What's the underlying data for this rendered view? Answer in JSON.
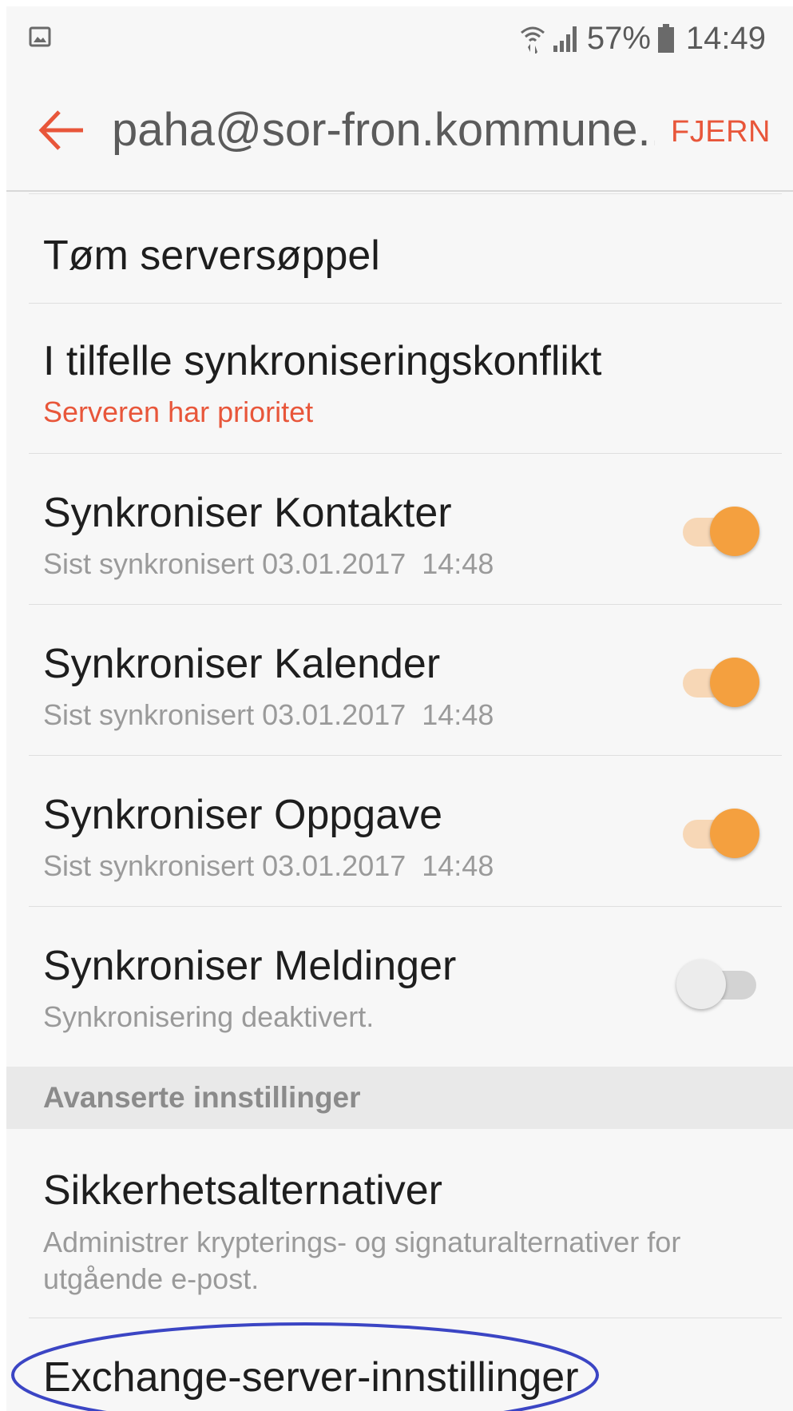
{
  "status_bar": {
    "battery": "57%",
    "time": "14:49",
    "icons": [
      "gallery-icon",
      "wifi-icon",
      "signal-icon",
      "battery-icon"
    ]
  },
  "action_bar": {
    "back_icon": "back-arrow-icon",
    "title": "paha@sor-fron.kommune...",
    "remove_label": "FJERN"
  },
  "settings": [
    {
      "title": "Tøm serversøppel"
    },
    {
      "title": "I tilfelle synkroniseringskonflikt",
      "value": "Serveren har prioritet"
    },
    {
      "title": "Synkroniser Kontakter",
      "subtitle": "Sist synkronisert 03.01.2017  14:48",
      "enabled": true
    },
    {
      "title": "Synkroniser Kalender",
      "subtitle": "Sist synkronisert 03.01.2017  14:48",
      "enabled": true
    },
    {
      "title": "Synkroniser Oppgave",
      "subtitle": "Sist synkronisert 03.01.2017  14:48",
      "enabled": true
    },
    {
      "title": "Synkroniser Meldinger",
      "subtitle": "Synkronisering deaktivert.",
      "enabled": false
    }
  ],
  "advanced": {
    "header": "Avanserte innstillinger",
    "security": {
      "title": "Sikkerhetsalternativer",
      "description_line1": "Administrer krypterings- og signaturalternativer for",
      "description_line2": "utgående e-post."
    },
    "exchange": {
      "title": "Exchange-server-innstillinger"
    }
  },
  "colors": {
    "accent": "#e8563a",
    "toggle_on": "#f4a03f",
    "annotation": "#3b45c4"
  }
}
